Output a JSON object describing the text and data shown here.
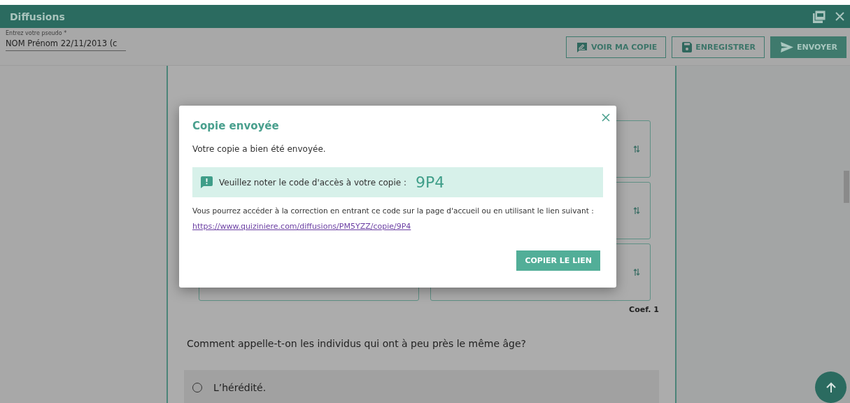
{
  "window": {
    "title": "Diffusions"
  },
  "pseudo_field": {
    "label": "Entrez votre pseudo *",
    "value": "NOM Prénom 22/11/2013 (c"
  },
  "toolbar": {
    "buttons": [
      {
        "label": "VOIR MA COPIE",
        "kind": "outline"
      },
      {
        "label": "ENREGISTRER",
        "kind": "outline"
      },
      {
        "label": "ENVOYER",
        "kind": "filled"
      }
    ]
  },
  "question_block": {
    "coefficient": "Coef. 1"
  },
  "question": {
    "text": "Comment appelle-t-on les individus qui ont à peu près le même âge?",
    "options": [
      {
        "label": "L’hérédité.",
        "selected": false
      }
    ]
  },
  "dialog": {
    "title": "Copie envoyée",
    "message": "Votre copie a bien été envoyée.",
    "notice": "Veuillez noter le code d'accès à votre copie :",
    "code": "9P4",
    "info": "Vous pourrez accéder à la correction en entrant ce code sur la page d'accueil ou en utilisant le lien suivant :",
    "link": "https://www.quiziniere.com/diffusions/PM5YZZ/copie/9P4",
    "button": "COPIER LE LIEN"
  }
}
